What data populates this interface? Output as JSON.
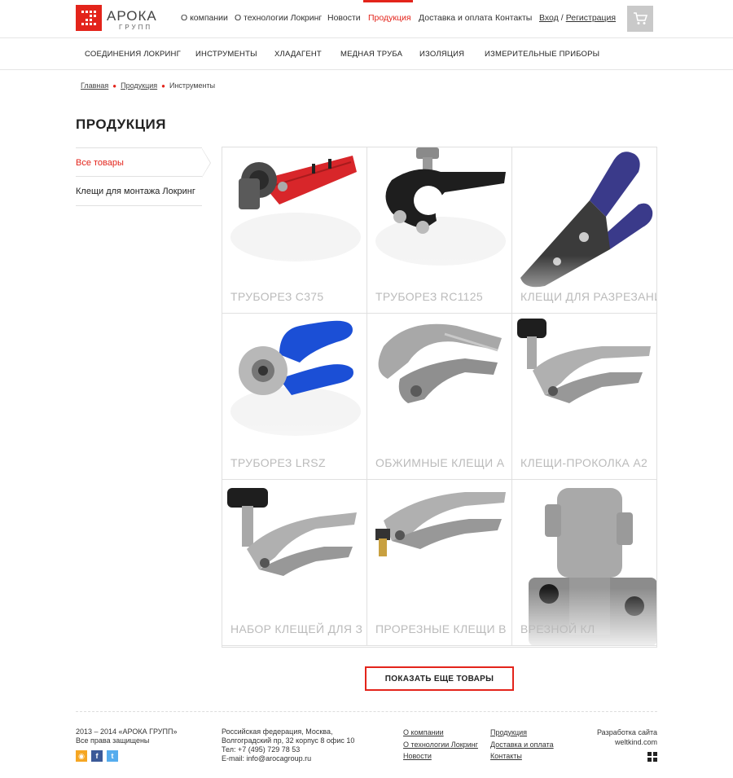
{
  "brand": {
    "name": "АРОКА",
    "sub": "ГРУПП"
  },
  "topnav": [
    {
      "label": "О компании",
      "active": false
    },
    {
      "label": "О технологии Локринг",
      "active": false
    },
    {
      "label": "Новости",
      "active": false
    },
    {
      "label": "Продукция",
      "active": true
    },
    {
      "label": "Доставка и оплата",
      "active": false
    },
    {
      "label": "Контакты",
      "active": false
    }
  ],
  "auth": {
    "login": "Вход",
    "separator": "/",
    "register": "Регистрация"
  },
  "categories": [
    "СОЕДИНЕНИЯ ЛОКРИНГ",
    "ИНСТРУМЕНТЫ",
    "ХЛАДАГЕНТ",
    "МЕДНАЯ ТРУБА",
    "ИЗОЛЯЦИЯ",
    "ИЗМЕРИТЕЛЬНЫЕ ПРИБОРЫ"
  ],
  "breadcrumb": [
    "Главная",
    "Продукция",
    "Инструменты"
  ],
  "page_title": "ПРОДУКЦИЯ",
  "sidebar": [
    {
      "label": "Все товары",
      "active": true
    },
    {
      "label": "Клещи для монтажа Локринг",
      "active": false
    }
  ],
  "products": [
    {
      "label": "ТРУБОРЕЗ С375",
      "icon": "red-tube-cutter-image"
    },
    {
      "label": "ТРУБОРЕЗ RC1125",
      "icon": "black-tube-cutter-image"
    },
    {
      "label": "КЛЕЩИ ДЛЯ РАЗРЕЗАНИЯ",
      "icon": "cutting-pliers-image"
    },
    {
      "label": "ТРУБОРЕЗ LRSZ",
      "icon": "blue-tube-cutter-image"
    },
    {
      "label": "ОБЖИМНЫЕ КЛЕЩИ А",
      "icon": "crimping-pliers-image"
    },
    {
      "label": "КЛЕЩИ-ПРОКОЛКА А2",
      "icon": "piercing-pliers-image"
    },
    {
      "label": "НАБОР КЛЕЩЕЙ ДЛЯ З",
      "icon": "pliers-set-image"
    },
    {
      "label": "ПРОРЕЗНЫЕ КЛЕЩИ В",
      "icon": "slotting-pliers-image"
    },
    {
      "label": "ВРЕЗНОЙ КЛ",
      "icon": "tap-valve-image"
    }
  ],
  "more_button": "ПОКАЗАТЬ ЕЩЕ ТОВАРЫ",
  "footer": {
    "copyright": [
      "2013 – 2014 «АРОКА ГРУПП»",
      "Все права защищены"
    ],
    "address": [
      "Российская федерация, Москва,",
      "Волгоградский пр, 32 корпус 8 офис 10",
      "Тел: +7 (495) 729 78 53",
      "E-mail: info@arocagroup.ru"
    ],
    "links_col1": [
      "О компании",
      "О технологии Локринг",
      "Новости"
    ],
    "links_col2": [
      "Продукция",
      "Доставка и оплата",
      "Контакты"
    ],
    "developer": [
      "Разработка сайта",
      "weltkind.com"
    ]
  },
  "colors": {
    "accent": "#e3241b",
    "rss": "#f5a623",
    "facebook": "#3b5998",
    "twitter": "#55acee"
  }
}
